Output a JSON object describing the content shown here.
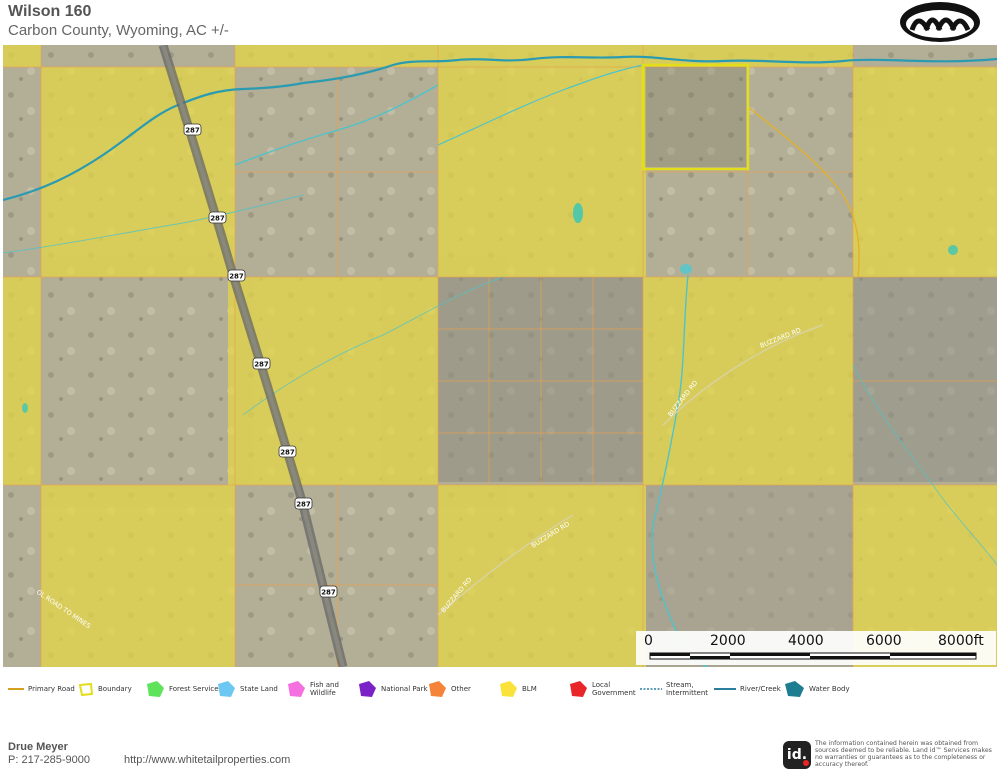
{
  "header": {
    "title": "Wilson 160",
    "subtitle": "Carbon County, Wyoming,  AC +/-"
  },
  "map": {
    "roads": {
      "highway_shield": "287",
      "buzzard_rd": "BUZZARD RD",
      "ol_road_to_mines": "OL ROAD TO MINES"
    },
    "scale": {
      "labels": [
        "0",
        "2000",
        "4000",
        "6000",
        "8000ft"
      ]
    },
    "colors": {
      "blm": "#e6d844",
      "stream": "#4fc3c9",
      "river": "#2a9bb0",
      "boundary": "#e3de1a",
      "primary_road": "#d4a020"
    }
  },
  "legend": [
    {
      "icon": "primary-road-line-icon",
      "label": "Primary Road",
      "color": "#d4a020"
    },
    {
      "icon": "boundary-polygon-icon",
      "label": "Boundary",
      "color": "#e3de1a"
    },
    {
      "icon": "forest-service-polygon-icon",
      "label": "Forest Service",
      "color": "#5ee35a"
    },
    {
      "icon": "state-land-polygon-icon",
      "label": "State Land",
      "color": "#6cc8f2"
    },
    {
      "icon": "fish-wildlife-polygon-icon",
      "label": "Fish and Wildlife",
      "color": "#f56fe0"
    },
    {
      "icon": "national-park-polygon-icon",
      "label": "National Park",
      "color": "#7b22c7"
    },
    {
      "icon": "other-polygon-icon",
      "label": "Other",
      "color": "#f5843a"
    },
    {
      "icon": "blm-polygon-icon",
      "label": "BLM",
      "color": "#fbe23a"
    },
    {
      "icon": "local-government-polygon-icon",
      "label": "Local Government",
      "color": "#e8262a"
    },
    {
      "icon": "stream-intermittent-line-icon",
      "label": "Stream, Intermittent",
      "color": "#2a7fa0"
    },
    {
      "icon": "river-creek-line-icon",
      "label": "River/Creek",
      "color": "#2a7fa0"
    },
    {
      "icon": "water-body-polygon-icon",
      "label": "Water Body",
      "color": "#1f7d92"
    }
  ],
  "footer": {
    "agent_name": "Drue Meyer",
    "agent_phone": "P: 217-285-9000",
    "website": "http://www.whitetailproperties.com",
    "id_logo": "id.",
    "disclaimer": "The information contained herein was obtained from sources deemed to be reliable. Land id™ Services makes no warranties or guarantees as to the completeness or accuracy thereof."
  }
}
